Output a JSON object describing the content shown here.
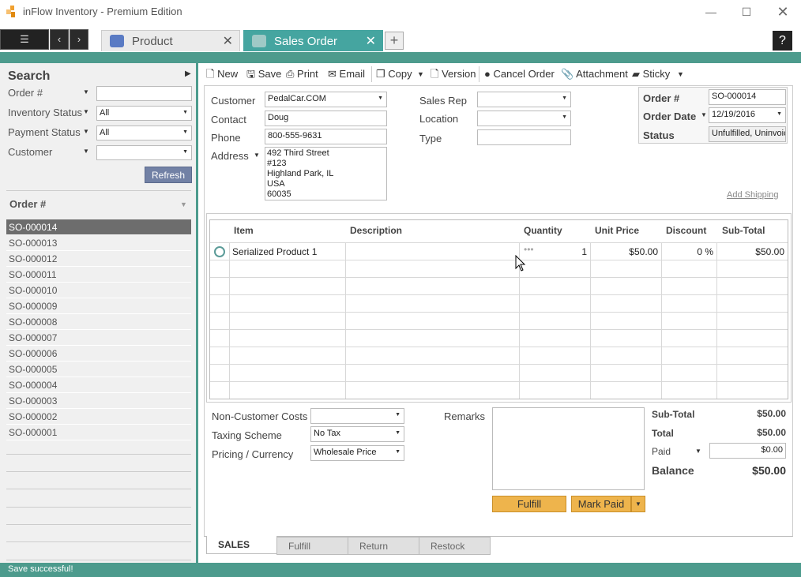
{
  "window": {
    "title": "inFlow Inventory - Premium Edition"
  },
  "tabs": [
    {
      "label": "Product"
    },
    {
      "label": "Sales Order"
    }
  ],
  "help_label": "?",
  "search": {
    "title": "Search",
    "fields": [
      {
        "label": "Order #",
        "value": ""
      },
      {
        "label": "Inventory Status",
        "value": "All"
      },
      {
        "label": "Payment Status",
        "value": "All"
      },
      {
        "label": "Customer",
        "value": ""
      }
    ],
    "refresh_label": "Refresh"
  },
  "order_list": {
    "header": "Order #",
    "items": [
      "SO-000014",
      "SO-000013",
      "SO-000012",
      "SO-000011",
      "SO-000010",
      "SO-000009",
      "SO-000008",
      "SO-000007",
      "SO-000006",
      "SO-000005",
      "SO-000004",
      "SO-000003",
      "SO-000002",
      "SO-000001"
    ],
    "selected": "SO-000014"
  },
  "toolbar": {
    "new": "New",
    "save": "Save",
    "print": "Print",
    "email": "Email",
    "copy": "Copy",
    "version": "Version",
    "cancel_order": "Cancel Order",
    "attachment": "Attachment",
    "sticky": "Sticky"
  },
  "form": {
    "customer_label": "Customer",
    "customer": "PedalCar.COM",
    "contact_label": "Contact",
    "contact": "Doug",
    "phone_label": "Phone",
    "phone": "800-555-9631",
    "address_label": "Address",
    "address_lines": [
      "492 Third Street",
      "#123",
      "Highland Park, IL",
      "USA",
      "60035"
    ],
    "sales_rep_label": "Sales Rep",
    "sales_rep": "",
    "location_label": "Location",
    "location": "",
    "type_label": "Type",
    "type": "",
    "order_no_label": "Order #",
    "order_no": "SO-000014",
    "order_date_label": "Order Date",
    "order_date": "12/19/2016",
    "status_label": "Status",
    "status": "Unfulfilled, Uninvoic",
    "add_shipping": "Add Shipping"
  },
  "grid": {
    "columns": [
      "Item",
      "Description",
      "Quantity",
      "Unit Price",
      "Discount",
      "Sub-Total"
    ],
    "rows": [
      {
        "item": "Serialized Product 1",
        "description": "",
        "quantity": "1",
        "unit_price": "$50.00",
        "discount": "0 %",
        "subtotal": "$50.00"
      }
    ]
  },
  "footer": {
    "non_customer_costs_label": "Non-Customer Costs",
    "non_customer_costs": "",
    "taxing_scheme_label": "Taxing Scheme",
    "taxing_scheme": "No Tax",
    "pricing_label": "Pricing / Currency",
    "pricing": "Wholesale Price",
    "remarks_label": "Remarks",
    "subtotal_label": "Sub-Total",
    "subtotal": "$50.00",
    "total_label": "Total",
    "total": "$50.00",
    "paid_label": "Paid",
    "paid": "$0.00",
    "balance_label": "Balance",
    "balance": "$50.00",
    "fulfill_label": "Fulfill",
    "mark_paid_label": "Mark Paid"
  },
  "bottom_tabs": [
    "SALES",
    "Fulfill",
    "Return",
    "Restock"
  ],
  "status_bar": "Save successful!"
}
